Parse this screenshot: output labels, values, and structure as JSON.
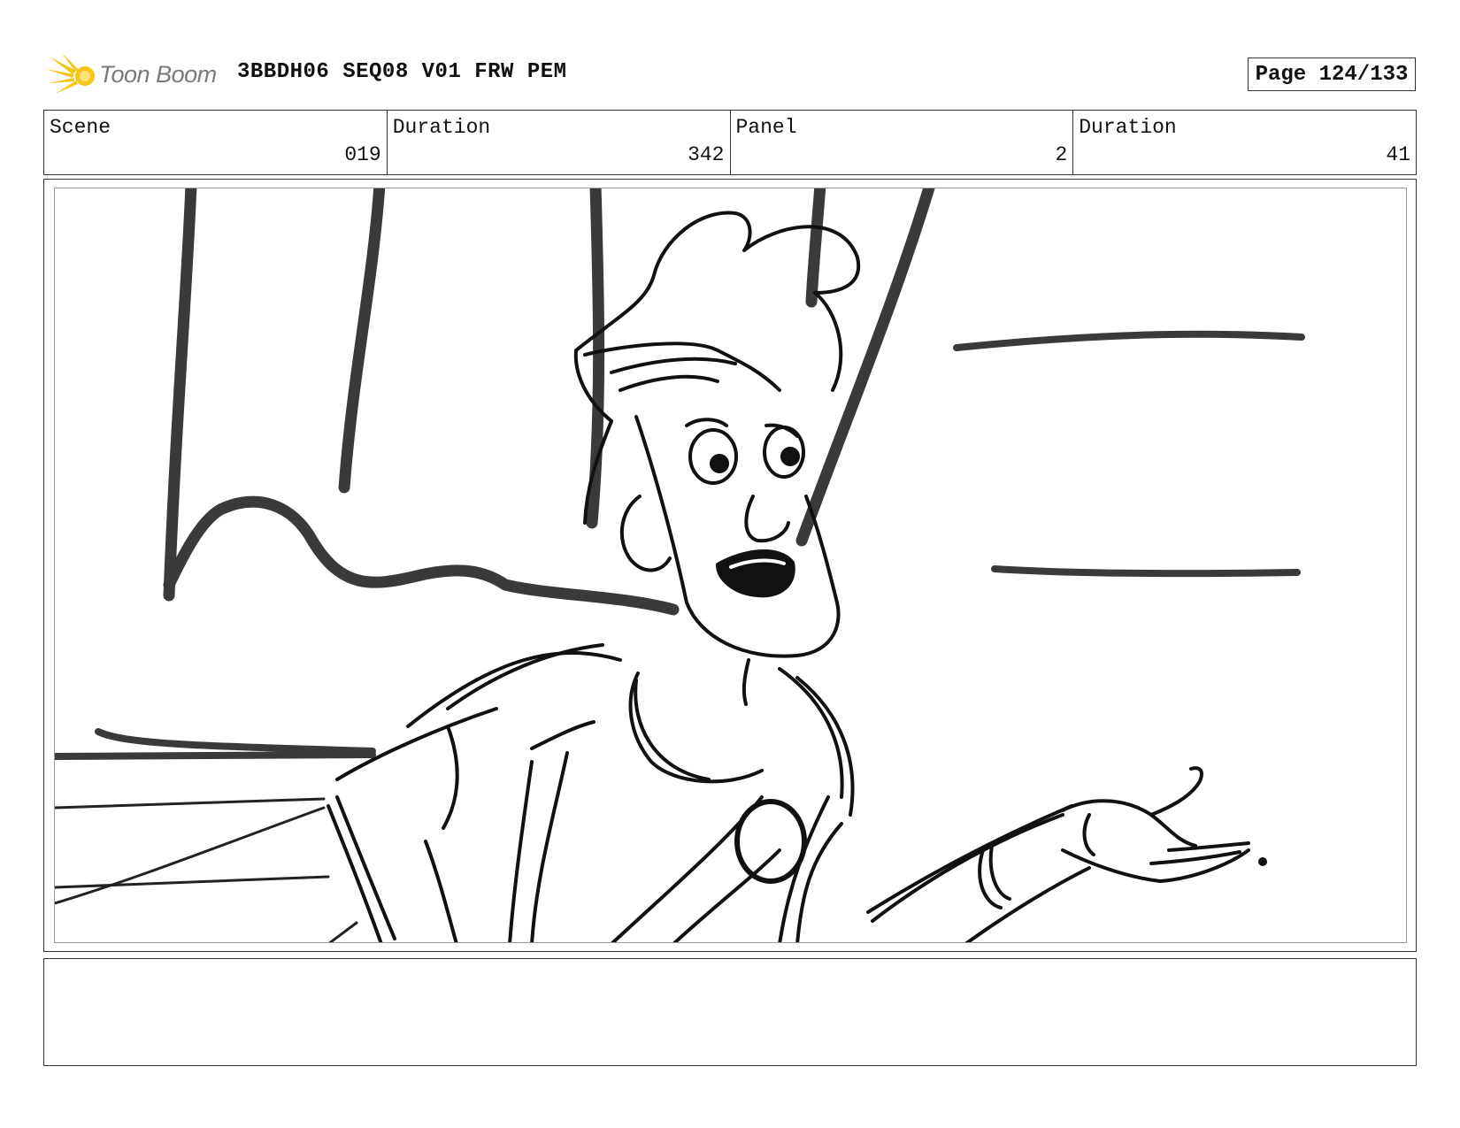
{
  "header": {
    "logo_text": "Toon Boom",
    "document_title": "3BBDH06 SEQ08 V01 FRW PEM",
    "page_label": "Page 124/133"
  },
  "info": {
    "scene_label": "Scene",
    "scene_value": "019",
    "scene_duration_label": "Duration",
    "scene_duration_value": "342",
    "panel_label": "Panel",
    "panel_value": "2",
    "panel_duration_label": "Duration",
    "panel_duration_value": "41"
  },
  "panel": {
    "sketch": "storyboard-sketch-character-gesturing"
  },
  "notes": {
    "text": ""
  }
}
